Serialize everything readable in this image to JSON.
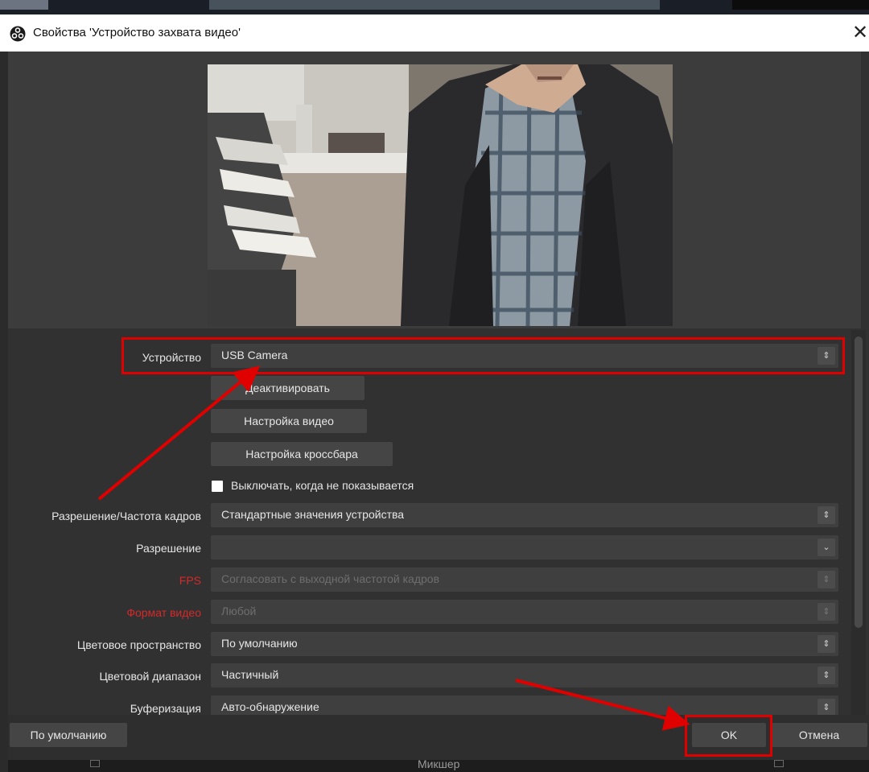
{
  "window": {
    "title": "Свойства 'Устройство захвата видео'",
    "close_glyph": "✕",
    "icon": "obs-logo-icon"
  },
  "preview": {
    "label": "camera-preview-image"
  },
  "device": {
    "label": "Устройство",
    "value": "USB Camera"
  },
  "buttons": {
    "deactivate": "Деактивировать",
    "video_config": "Настройка видео",
    "crossbar_config": "Настройка кроссбара"
  },
  "deactivate_when_hidden": {
    "label": "Выключать, когда не показывается",
    "checked": false
  },
  "fields": [
    {
      "label": "Разрешение/Частота кадров",
      "value": "Стандартные значения устройства",
      "disabled": false,
      "red": false,
      "arrow": "⇕"
    },
    {
      "label": "Разрешение",
      "value": "",
      "disabled": false,
      "red": false,
      "arrow": "⌄"
    },
    {
      "label": "FPS",
      "value": "Согласовать с выходной частотой кадров",
      "disabled": true,
      "red": true,
      "arrow": "⇕"
    },
    {
      "label": "Формат видео",
      "value": "Любой",
      "disabled": true,
      "red": true,
      "arrow": "⇕"
    },
    {
      "label": "Цветовое пространство",
      "value": "По умолчанию",
      "disabled": false,
      "red": false,
      "arrow": "⇕"
    },
    {
      "label": "Цветовой диапазон",
      "value": "Частичный",
      "disabled": false,
      "red": false,
      "arrow": "⇕"
    },
    {
      "label": "Буферизация",
      "value": "Авто-обнаружение",
      "disabled": false,
      "red": false,
      "arrow": "⇕"
    }
  ],
  "footer": {
    "defaults": "По умолчанию",
    "ok": "OK",
    "cancel": "Отмена"
  },
  "mixer": {
    "label": "Микшер"
  },
  "colors": {
    "annotation": "#e00000",
    "background": "#313131",
    "field": "#3f3f3f",
    "disabled_label": "#d42a2a"
  }
}
